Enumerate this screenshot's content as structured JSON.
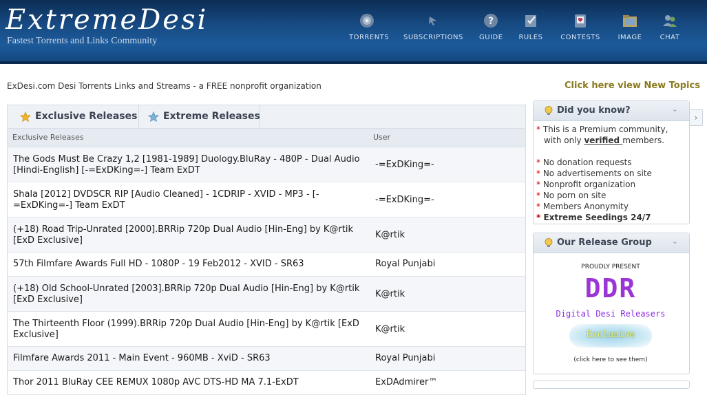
{
  "header": {
    "logo": "ExtremeDesi",
    "tagline": "Fastest Torrents and Links Community",
    "nav": [
      {
        "label": "TORRENTS",
        "icon": "globe-icon"
      },
      {
        "label": "SUBSCRIPTIONS",
        "icon": "rss-icon"
      },
      {
        "label": "GUIDE",
        "icon": "help-icon"
      },
      {
        "label": "RULES",
        "icon": "checklist-icon"
      },
      {
        "label": "CONTESTS",
        "icon": "trophy-icon"
      },
      {
        "label": "IMAGE",
        "icon": "image-folder-icon"
      },
      {
        "label": "CHAT",
        "icon": "chat-users-icon"
      }
    ]
  },
  "subtitle": "ExDesi.com Desi Torrents Links and Streams - a FREE nonprofit organization",
  "new_topics": "Click here view New Topics",
  "tabs": [
    {
      "label": "Exclusive Releases",
      "icon": "gold-star-icon"
    },
    {
      "label": "Extreme Releases",
      "icon": "blue-star-icon"
    }
  ],
  "table": {
    "headers": [
      "Exclusive Releases",
      "User"
    ],
    "rows": [
      {
        "title": "The Gods Must Be Crazy 1,2 [1981-1989] Duology.BluRay - 480P - Dual Audio [Hindi-English] [-=ExDKing=-] Team ExDT",
        "user": "-=ExDKing=-"
      },
      {
        "title": "Shala [2012] DVDSCR RIP [Audio Cleaned] - 1CDRIP - XVID - MP3 - [-=ExDKing=-] Team ExDT",
        "user": "-=ExDKing=-"
      },
      {
        "title": "(+18) Road Trip-Unrated [2000].BRRip 720p Dual Audio [Hin-Eng] by K@rtik [ExD Exclusive]",
        "user": "K@rtik"
      },
      {
        "title": "57th Filmfare Awards Full HD - 1080P - 19 Feb2012 - XVID - SR63",
        "user": "Royal Punjabi"
      },
      {
        "title": "(+18) Old School-Unrated [2003].BRRip 720p Dual Audio [Hin-Eng] by K@rtik [ExD Exclusive]",
        "user": "K@rtik"
      },
      {
        "title": "The Thirteenth Floor (1999).BRRip 720p Dual Audio [Hin-Eng] by K@rtik [ExD Exclusive]",
        "user": "K@rtik"
      },
      {
        "title": "Filmfare Awards 2011 - Main Event - 960MB - XviD - SR63",
        "user": "Royal Punjabi"
      },
      {
        "title": "Thor 2011 BluRay CEE REMUX 1080p AVC DTS-HD MA 7.1-ExDT",
        "user": "ExDAdmirer™"
      }
    ]
  },
  "did_you_know": {
    "title": "Did you know?",
    "intro_1": "This is a Premium community,",
    "intro_2a": "with only ",
    "intro_2b": "verified ",
    "intro_2c": "members.",
    "items": [
      "No donation requests",
      "No advertisements on site",
      "Nonprofit organization",
      "No porn on site",
      "Members Anonymity",
      "Extreme Seedings 24/7"
    ]
  },
  "release_group": {
    "title": "Our Release Group",
    "proudly": "PROUDLY PRESENT",
    "logo": "DDR",
    "name": "Digital Desi Releasers",
    "exclusive": "Exclusive",
    "click": "(click here to see them)"
  },
  "colors": {
    "header": "#174a82",
    "accent_gold": "#8a7a1e",
    "asterisk": "#cc0000",
    "ddr_purple": "#8a2be2"
  }
}
